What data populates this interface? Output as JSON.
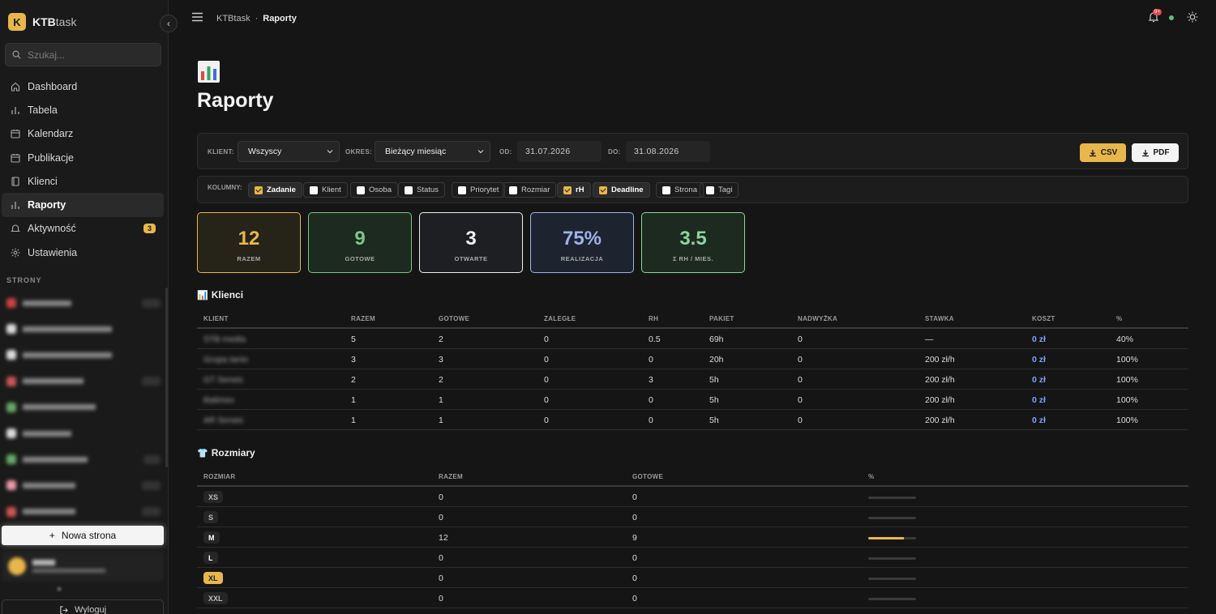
{
  "app": {
    "logo_letter": "K",
    "name_bold": "KTB",
    "name_light": "task"
  },
  "search": {
    "placeholder": "Szukaj..."
  },
  "nav": [
    {
      "label": "Dashboard",
      "icon": "home-icon"
    },
    {
      "label": "Tabela",
      "icon": "bar-chart-icon"
    },
    {
      "label": "Kalendarz",
      "icon": "calendar-icon"
    },
    {
      "label": "Publikacje",
      "icon": "calendar-icon"
    },
    {
      "label": "Klienci",
      "icon": "book-icon"
    },
    {
      "label": "Raporty",
      "icon": "bar-chart-icon",
      "active": true
    },
    {
      "label": "Aktywność",
      "icon": "bell-icon",
      "badge": "3"
    },
    {
      "label": "Ustawienia",
      "icon": "gear-icon"
    }
  ],
  "sidebar": {
    "section_label": "STRONY",
    "new_page": "Nowa strona",
    "logout": "Wyloguj"
  },
  "breadcrumb": {
    "root": "KTBtask",
    "sep": "·",
    "current": "Raporty"
  },
  "topbar": {
    "notif_badge": "9+"
  },
  "page": {
    "title": "Raporty",
    "icon": "📊"
  },
  "filters": {
    "client_label": "KLIENT:",
    "client_value": "Wszyscy",
    "period_label": "OKRES:",
    "period_value": "Bieżący miesiąc",
    "from_label": "OD:",
    "from_value": "31.07.2026",
    "to_label": "DO:",
    "to_value": "31.08.2026",
    "csv": "CSV",
    "pdf": "PDF"
  },
  "columns": {
    "label": "KOLUMNY:",
    "items": [
      {
        "label": "Zadanie",
        "on": true
      },
      {
        "label": "Klient",
        "on": false
      },
      {
        "label": "Osoba",
        "on": false
      },
      {
        "label": "Status",
        "on": false
      },
      {
        "label": "Priorytet",
        "on": false
      },
      {
        "label": "Rozmiar",
        "on": false
      },
      {
        "label": "rH",
        "on": true
      },
      {
        "label": "Deadline",
        "on": true
      },
      {
        "label": "Strona",
        "on": false
      },
      {
        "label": "Tagi",
        "on": false
      }
    ]
  },
  "stats": [
    {
      "value": "12",
      "label": "RAZEM",
      "color": "#e8b64a"
    },
    {
      "value": "9",
      "label": "GOTOWE",
      "color": "#7fc488"
    },
    {
      "value": "3",
      "label": "OTWARTE",
      "color": "#f0f0f0"
    },
    {
      "value": "75%",
      "label": "REALIZACJA",
      "color": "#9db3e8"
    },
    {
      "value": "3.5",
      "label": "Σ RH / MIES.",
      "color": "#8fd39a"
    }
  ],
  "clients": {
    "title": "Klienci",
    "icon": "📊",
    "headers": [
      "KLIENT",
      "RAZEM",
      "GOTOWE",
      "ZALEGŁE",
      "RH",
      "PAKIET",
      "NADWYŻKA",
      "STAWKA",
      "KOSZT",
      "%"
    ],
    "rows": [
      [
        "STB media",
        "5",
        "2",
        "0",
        "0.5",
        "69h",
        "0",
        "—",
        "0 zł",
        "40%"
      ],
      [
        "Grupa tanio",
        "3",
        "3",
        "0",
        "0",
        "20h",
        "0",
        "200 zł/h",
        "0 zł",
        "100%"
      ],
      [
        "GT Serwis",
        "2",
        "2",
        "0",
        "3",
        "5h",
        "0",
        "200 zł/h",
        "0 zł",
        "100%"
      ],
      [
        "Batimex",
        "1",
        "1",
        "0",
        "0",
        "5h",
        "0",
        "200 zł/h",
        "0 zł",
        "100%"
      ],
      [
        "AR Serwis",
        "1",
        "1",
        "0",
        "0",
        "5h",
        "0",
        "200 zł/h",
        "0 zł",
        "100%"
      ]
    ]
  },
  "sizes": {
    "title": "Rozmiary",
    "icon": "👕",
    "headers": [
      "ROZMIAR",
      "RAZEM",
      "GOTOWE",
      "%"
    ],
    "rows": [
      {
        "size": "XS",
        "total": "0",
        "done": "0",
        "pct": 0
      },
      {
        "size": "S",
        "total": "0",
        "done": "0",
        "pct": 0
      },
      {
        "size": "M",
        "total": "12",
        "done": "9",
        "pct": 75
      },
      {
        "size": "L",
        "total": "0",
        "done": "0",
        "pct": 0
      },
      {
        "size": "XL",
        "total": "0",
        "done": "0",
        "pct": 0
      },
      {
        "size": "XXL",
        "total": "0",
        "done": "0",
        "pct": 0
      }
    ]
  }
}
